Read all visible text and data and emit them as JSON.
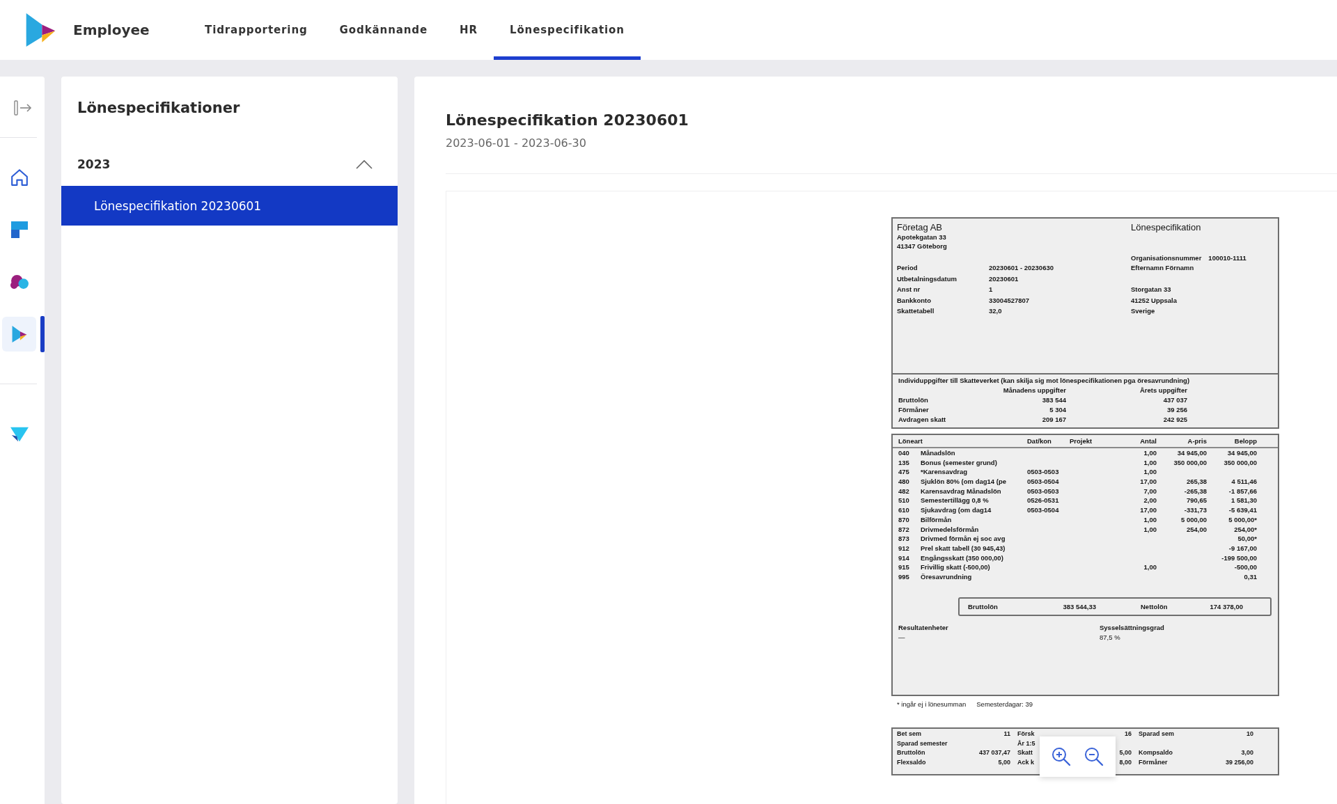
{
  "nav": {
    "brand": "Employee",
    "tabs": [
      {
        "label": "Tidrapportering",
        "selected": false
      },
      {
        "label": "Godkännande",
        "selected": false
      },
      {
        "label": "HR",
        "selected": false
      },
      {
        "label": "Lönespecifikation",
        "selected": true
      }
    ]
  },
  "rail": {
    "groups": [
      {
        "items": [
          {
            "selected": false
          },
          {
            "selected": false
          },
          {
            "selected": false
          },
          {
            "selected": true
          }
        ]
      },
      {
        "items": [
          {
            "selected": false
          }
        ]
      }
    ]
  },
  "sidebar": {
    "title": "Lönespecifikationer",
    "groups": [
      {
        "label": "2023",
        "expanded": true,
        "items": [
          {
            "label": "Lönespecifikation 20230601",
            "selected": true
          }
        ]
      }
    ]
  },
  "main": {
    "title": "Lönespecifikation 20230601",
    "period": "2023-06-01 - 2023-06-30",
    "payslip": {
      "company": {
        "name": "Företag AB",
        "address": [
          "Apotekgatan 33",
          "41347 Göteborg"
        ]
      },
      "title": "Lönespecifikation",
      "org_number": {
        "label": "Organisationsnummer",
        "value": "100010-1111"
      },
      "fields": [
        {
          "label": "Period",
          "value": "20230601 - 20230630",
          "recipient": "Efternamn Förnamn"
        },
        {
          "label": "Utbetalningsdatum",
          "value": "20230601"
        },
        {
          "label": "Anst nr",
          "value": "1",
          "recipient": "Storgatan 33"
        },
        {
          "label": "Bankkonto",
          "value": "33004527807",
          "recipient": "41252 Uppsala"
        },
        {
          "label": "Skattetabell",
          "value": "32,0",
          "recipient": "Sverige"
        }
      ],
      "tax_report": {
        "title": "Individuppgifter till Skatteverket (kan skilja sig mot lönespecifikationen pga öresavrundning)",
        "columns": [
          "Månadens uppgifter",
          "Årets uppgifter"
        ],
        "rows": [
          {
            "label": "Bruttolön",
            "month": "383 544",
            "year": "437 037"
          },
          {
            "label": "Förmåner",
            "month": "5 304",
            "year": "39 256"
          },
          {
            "label": "Avdragen skatt",
            "month": "209 167",
            "year": "242 925"
          }
        ]
      },
      "lines": {
        "columns": [
          "Löneart",
          "Dat/kon",
          "Projekt",
          "Antal",
          "A-pris",
          "Belopp"
        ],
        "rows": [
          {
            "code": "040",
            "name": "Månadslön",
            "quantity": "1,00",
            "price": "34 945,00",
            "amount": "34 945,00"
          },
          {
            "code": "135",
            "name": "Bonus (semester grund)",
            "quantity": "1,00",
            "price": "350 000,00",
            "amount": "350 000,00"
          },
          {
            "code": "475",
            "name": "*Karensavdrag",
            "period": "0503-0503",
            "quantity": "1,00"
          },
          {
            "code": "480",
            "name": "Sjuklön 80% (om dag14 (pe",
            "period": "0503-0504",
            "quantity": "17,00",
            "price": "265,38",
            "amount": "4 511,46"
          },
          {
            "code": "482",
            "name": "Karensavdrag Månadslön",
            "period": "0503-0503",
            "quantity": "7,00",
            "price": "-265,38",
            "amount": "-1 857,66"
          },
          {
            "code": "510",
            "name": "Semestertillägg 0,8 %",
            "period": "0526-0531",
            "quantity": "2,00",
            "price": "790,65",
            "amount": "1 581,30"
          },
          {
            "code": "610",
            "name": "Sjukavdrag (om dag14",
            "period": "0503-0504",
            "quantity": "17,00",
            "price": "-331,73",
            "amount": "-5 639,41"
          },
          {
            "code": "870",
            "name": "Bilförmån",
            "quantity": "1,00",
            "price": "5 000,00",
            "amount": "5 000,00*"
          },
          {
            "code": "872",
            "name": "Drivmedelsförmån",
            "quantity": "1,00",
            "price": "254,00",
            "amount": "254,00*"
          },
          {
            "code": "873",
            "name": "Drivmed förmån ej soc avg",
            "amount": "50,00*"
          },
          {
            "code": "912",
            "name": "Prel skatt tabell (30 945,43)",
            "amount": "-9 167,00"
          },
          {
            "code": "914",
            "name": "Engångsskatt (350 000,00)",
            "amount": "-199 500,00"
          },
          {
            "code": "915",
            "name": "Frivillig skatt (-500,00)",
            "quantity": "1,00",
            "amount": "-500,00"
          },
          {
            "code": "995",
            "name": "Öresavrundning",
            "amount": "0,31"
          }
        ]
      },
      "totals": [
        {
          "label": "Bruttolön",
          "value": "383 544,33"
        },
        {
          "label": "Nettolön",
          "value": "174 378,00"
        }
      ],
      "results": [
        {
          "label": "Resultatenheter",
          "value": "—"
        },
        {
          "label": "Sysselsättningsgrad",
          "value": "87,5 %"
        }
      ],
      "footnotes": [
        "* ingår ej i lönesumman",
        "Semesterdagar: 39"
      ],
      "summary": [
        {
          "left": {
            "label": "Bet sem",
            "value": "11"
          },
          "middle": {
            "label": "Försk",
            "value": "16"
          },
          "right": {
            "label": "Sparad sem",
            "value": "10"
          }
        },
        {
          "left": {
            "label": "Sparad semester"
          },
          "middle": {
            "label": "År 1:5"
          }
        },
        {
          "left": {
            "label": "Bruttolön",
            "value": "437 037,47"
          },
          "middle": {
            "label": "Skatt",
            "value": "5,00"
          },
          "right": {
            "label": "Kompsaldo",
            "value": "3,00"
          }
        },
        {
          "left": {
            "label": "Flexsaldo",
            "value": "5,00"
          },
          "middle": {
            "label": "Ack k",
            "value": "8,00"
          },
          "right": {
            "label": "Förmåner",
            "value": "39 256,00"
          }
        }
      ]
    }
  }
}
